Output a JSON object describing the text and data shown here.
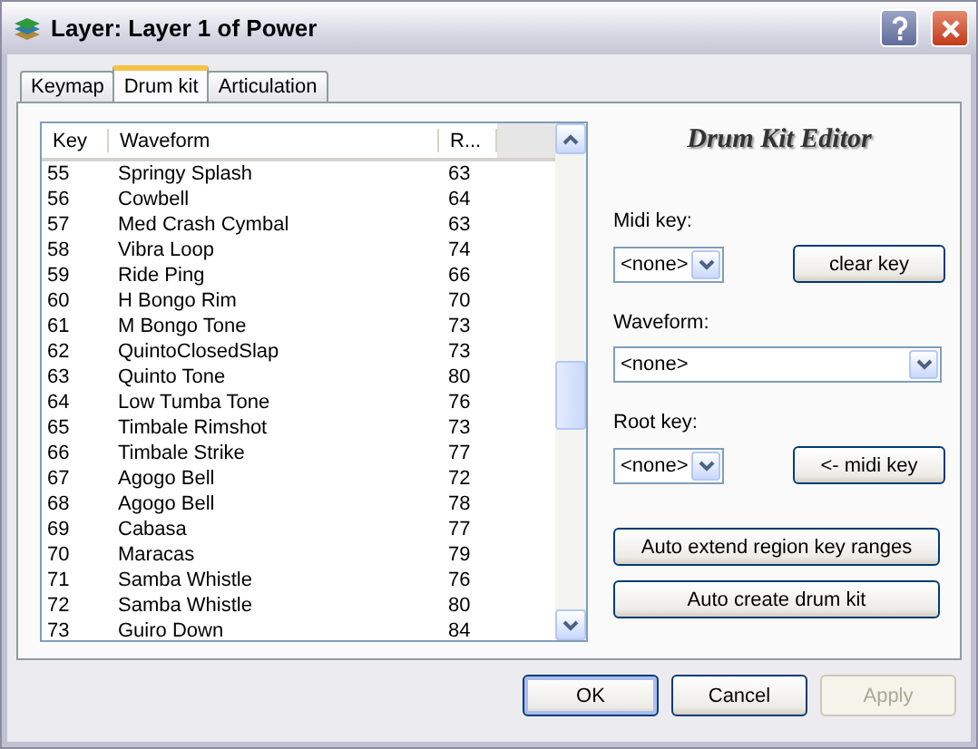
{
  "window": {
    "title": "Layer: Layer 1 of Power"
  },
  "tabs": [
    {
      "label": "Keymap",
      "selected": false
    },
    {
      "label": "Drum kit",
      "selected": true
    },
    {
      "label": "Articulation",
      "selected": false
    }
  ],
  "table": {
    "columns": [
      "Key",
      "Waveform",
      "R..."
    ],
    "rows": [
      [
        "55",
        "Springy Splash",
        "63"
      ],
      [
        "56",
        "Cowbell",
        "64"
      ],
      [
        "57",
        "Med Crash Cymbal",
        "63"
      ],
      [
        "58",
        "Vibra Loop",
        "74"
      ],
      [
        "59",
        "Ride Ping",
        "66"
      ],
      [
        "60",
        "H Bongo Rim",
        "70"
      ],
      [
        "61",
        "M Bongo Tone",
        "73"
      ],
      [
        "62",
        "QuintoClosedSlap",
        "73"
      ],
      [
        "63",
        "Quinto Tone",
        "80"
      ],
      [
        "64",
        "Low Tumba Tone",
        "76"
      ],
      [
        "65",
        "Timbale Rimshot",
        "73"
      ],
      [
        "66",
        "Timbale Strike",
        "77"
      ],
      [
        "67",
        "Agogo Bell",
        "72"
      ],
      [
        "68",
        "Agogo Bell",
        "78"
      ],
      [
        "69",
        "Cabasa",
        "77"
      ],
      [
        "70",
        "Maracas",
        "79"
      ],
      [
        "71",
        "Samba Whistle",
        "76"
      ],
      [
        "72",
        "Samba Whistle",
        "80"
      ],
      [
        "73",
        "Guiro Down",
        "84"
      ]
    ]
  },
  "editor": {
    "title": "Drum Kit Editor",
    "midi_key": {
      "label": "Midi key:",
      "value": "<none>",
      "button": "clear key"
    },
    "waveform": {
      "label": "Waveform:",
      "value": "<none>"
    },
    "root_key": {
      "label": "Root key:",
      "value": "<none>",
      "button": "<- midi key"
    },
    "actions": [
      "Auto extend region key ranges",
      "Auto create drum kit"
    ]
  },
  "buttons": [
    {
      "label": "OK",
      "disabled": false,
      "default": true
    },
    {
      "label": "Cancel",
      "disabled": false,
      "default": false
    },
    {
      "label": "Apply",
      "disabled": true,
      "default": false
    }
  ]
}
